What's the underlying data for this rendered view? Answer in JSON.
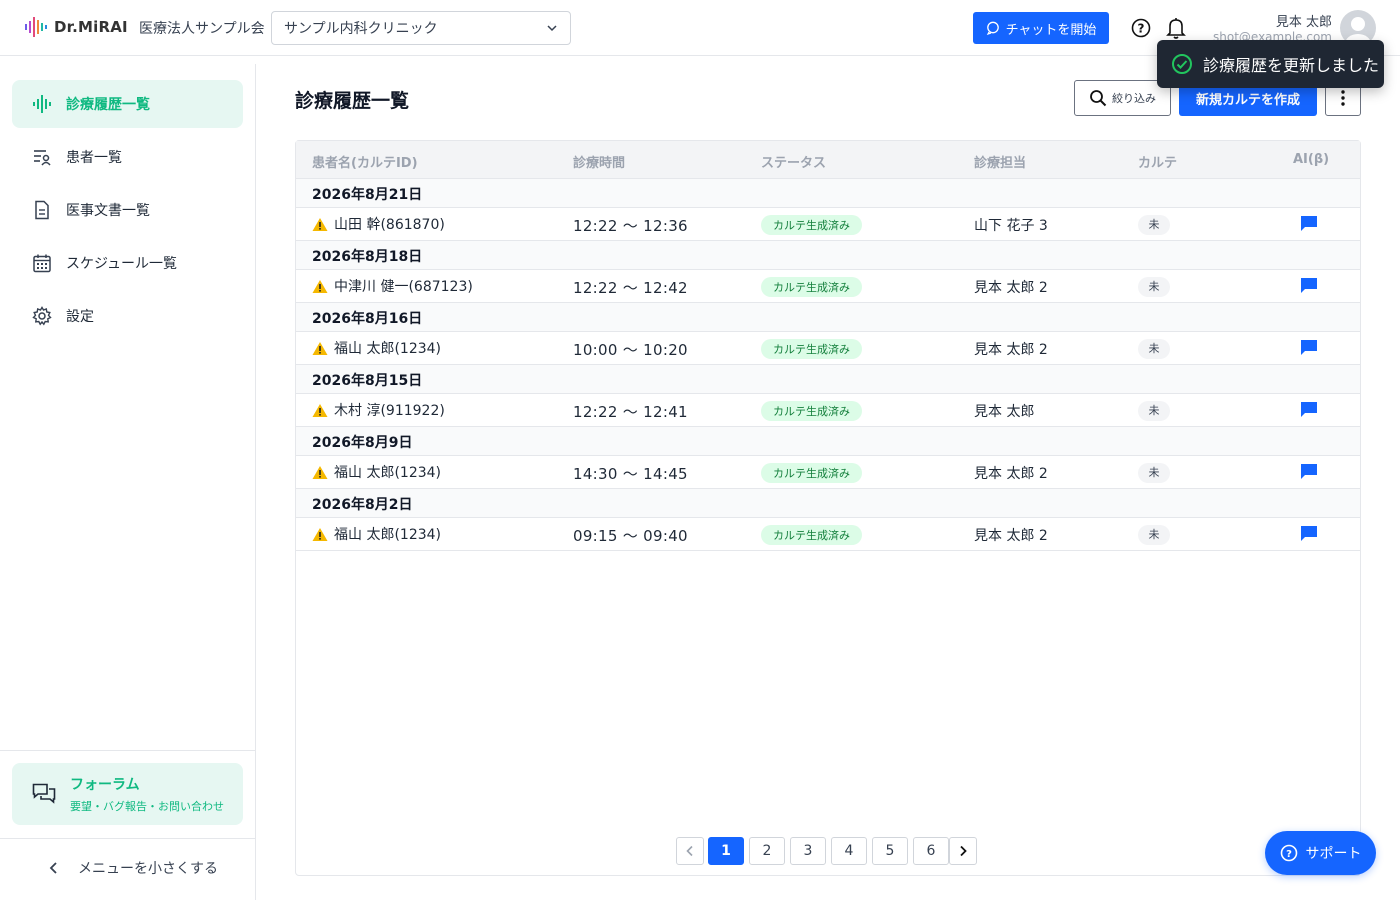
{
  "header": {
    "logo_text": "Dr.MiRAI",
    "org_name": "医療法人サンプル会",
    "clinic_selected": "サンプル内科クリニック",
    "chat_button": "チャットを開始",
    "user_name": "見本 太郎",
    "user_email": "shot@example.com"
  },
  "toast": {
    "message": "診療履歴を更新しました"
  },
  "sidebar": {
    "items": [
      {
        "label": "診療履歴一覧",
        "icon": "waveform-icon",
        "active": true
      },
      {
        "label": "患者一覧",
        "icon": "patient-list-icon"
      },
      {
        "label": "医事文書一覧",
        "icon": "document-icon"
      },
      {
        "label": "スケジュール一覧",
        "icon": "calendar-icon"
      },
      {
        "label": "設定",
        "icon": "gear-icon"
      }
    ],
    "forum": {
      "title": "フォーラム",
      "subtitle": "要望・バグ報告・お問い合わせ"
    },
    "collapse_label": "メニューを小さくする"
  },
  "main": {
    "title": "診療履歴一覧",
    "filter_button": "絞り込み",
    "new_button": "新規カルテを作成",
    "columns": [
      "患者名(カルテID)",
      "診療時間",
      "ステータス",
      "診療担当",
      "カルテ",
      "AI(β)"
    ],
    "groups": [
      {
        "date": "2026年8月21日",
        "rows": [
          {
            "patient": "山田 幹(861870)",
            "time": "12:22 ～ 12:36",
            "status": "カルテ生成済み",
            "doctor": "山下 花子 3",
            "karte": "未"
          }
        ]
      },
      {
        "date": "2026年8月18日",
        "rows": [
          {
            "patient": "中津川 健一(687123)",
            "time": "12:22 ～ 12:42",
            "status": "カルテ生成済み",
            "doctor": "見本 太郎 2",
            "karte": "未"
          }
        ]
      },
      {
        "date": "2026年8月16日",
        "rows": [
          {
            "patient": "福山 太郎(1234)",
            "time": "10:00 ～ 10:20",
            "status": "カルテ生成済み",
            "doctor": "見本 太郎 2",
            "karte": "未"
          }
        ]
      },
      {
        "date": "2026年8月15日",
        "rows": [
          {
            "patient": "木村 淳(911922)",
            "time": "12:22 ～ 12:41",
            "status": "カルテ生成済み",
            "doctor": "見本 太郎",
            "karte": "未"
          }
        ]
      },
      {
        "date": "2026年8月9日",
        "rows": [
          {
            "patient": "福山 太郎(1234)",
            "time": "14:30 ～ 14:45",
            "status": "カルテ生成済み",
            "doctor": "見本 太郎 2",
            "karte": "未"
          }
        ]
      },
      {
        "date": "2026年8月2日",
        "rows": [
          {
            "patient": "福山 太郎(1234)",
            "time": "09:15 ～ 09:40",
            "status": "カルテ生成済み",
            "doctor": "見本 太郎 2",
            "karte": "未"
          }
        ]
      }
    ],
    "pagination": {
      "pages": [
        "1",
        "2",
        "3",
        "4",
        "5",
        "6"
      ],
      "current": "1"
    }
  },
  "support_button": "サポート",
  "colors": {
    "primary": "#1565ff",
    "accent_green": "#10b981",
    "status_bg": "#dcfce7",
    "warning": "#f5b800"
  }
}
